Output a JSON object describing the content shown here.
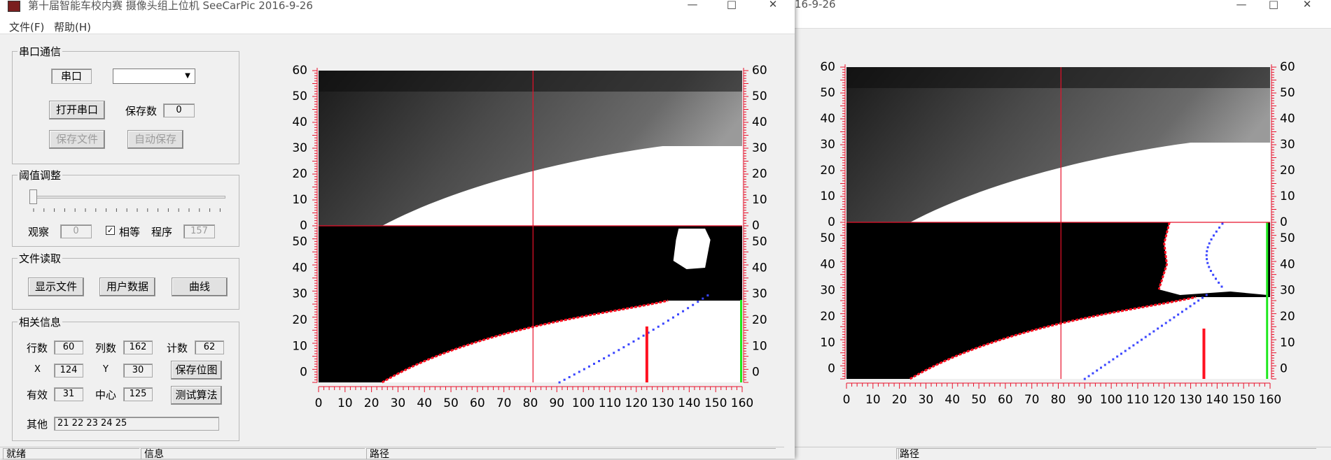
{
  "window": {
    "title": "第十届智能车校内赛 摄像头组上位机 SeeCarPic 2016-9-26",
    "minimize_glyph": "—",
    "maximize_glyph": "□",
    "close_glyph": "✕"
  },
  "back_window": {
    "title_fragment": "16-9-26",
    "status_path_label": "路径"
  },
  "menu": {
    "file": "文件(F)",
    "help": "帮助(H)"
  },
  "serial_group": {
    "title": "串口通信",
    "port_label": "串口",
    "port_value": "",
    "open_button": "打开串口",
    "save_count_label": "保存数",
    "save_count_value": "0",
    "save_file_button": "保存文件",
    "auto_save_button": "自动保存"
  },
  "threshold_group": {
    "title": "阈值调整",
    "slider_value": 0,
    "observe_label": "观察",
    "observe_value": "0",
    "equal_checked": true,
    "equal_label": "相等",
    "program_label": "程序",
    "program_value": "157"
  },
  "file_group": {
    "title": "文件读取",
    "show_file_button": "显示文件",
    "user_data_button": "用户数据",
    "curve_button": "曲线"
  },
  "info_group": {
    "title": "相关信息",
    "rows_label": "行数",
    "rows_value": "60",
    "cols_label": "列数",
    "cols_value": "162",
    "count_label": "计数",
    "count_value": "62",
    "x_label": "X",
    "x_value": "124",
    "y_label": "Y",
    "y_value": "30",
    "save_bitmap_button": "保存位图",
    "valid_label": "有效",
    "valid_value": "31",
    "center_label": "中心",
    "center_value": "125",
    "test_algo_button": "测试算法",
    "other_label": "其他",
    "other_value": "21 22 23 24 25"
  },
  "statusbar": {
    "ready": "就绪",
    "info": "信息",
    "path": "路径"
  },
  "plot_axes": {
    "y_ticks_top": [
      "60",
      "50",
      "40",
      "30",
      "20",
      "10",
      "0"
    ],
    "y_ticks_bottom": [
      "50",
      "40",
      "30",
      "20",
      "10",
      "0"
    ],
    "x_ticks": [
      "0",
      "10",
      "20",
      "30",
      "40",
      "50",
      "60",
      "70",
      "80",
      "90",
      "100",
      "110",
      "120",
      "130",
      "140",
      "150",
      "160"
    ]
  },
  "colors": {
    "grid_red": "#e8102a",
    "edge_red": "#ff1020",
    "center_blue": "#3b46ff",
    "edge_green": "#1fe81f",
    "track_white": "#ffffff",
    "background_black": "#000000"
  }
}
